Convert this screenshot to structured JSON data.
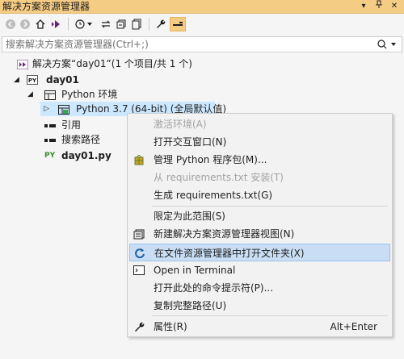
{
  "window": {
    "title": "解决方案资源管理器",
    "title_buttons": [
      "▾",
      "📌",
      "✕"
    ]
  },
  "search": {
    "placeholder": "搜索解决方案资源管理器(Ctrl+;)"
  },
  "tree": {
    "solution": "解决方案“day01”(1 个项目/共 1 个)",
    "project": "day01",
    "env_group": "Python 环境",
    "env_item": "Python 3.7 (64-bit) (全局默认值)",
    "references": "引用",
    "search_paths": "搜索路径",
    "file": "day01.py",
    "py_badge": "PY"
  },
  "context_menu": {
    "items": [
      {
        "label": "激活环境(A)",
        "enabled": false
      },
      {
        "label": "打开交互窗口(N)",
        "enabled": true
      },
      {
        "label": "管理 Python 程序包(M)...",
        "enabled": true
      },
      {
        "label": "从 requirements.txt 安装(T)",
        "enabled": false
      },
      {
        "label": "生成 requirements.txt(G)",
        "enabled": true
      },
      {
        "label": "限定为此范围(S)",
        "enabled": true
      },
      {
        "label": "新建解决方案资源管理器视图(N)",
        "enabled": true
      },
      {
        "label": "在文件资源管理器中打开文件夹(X)",
        "enabled": true,
        "highlighted": true
      },
      {
        "label": "Open in Terminal",
        "enabled": true
      },
      {
        "label": "打开此处的命令提示符(P)...",
        "enabled": true
      },
      {
        "label": "复制完整路径(U)",
        "enabled": true
      },
      {
        "label": "属性(R)",
        "enabled": true,
        "shortcut": "Alt+Enter"
      }
    ]
  },
  "colors": {
    "title_bar": "#f5cc84",
    "menu_highlight": "#c9def5",
    "accent_purple": "#68217a"
  }
}
